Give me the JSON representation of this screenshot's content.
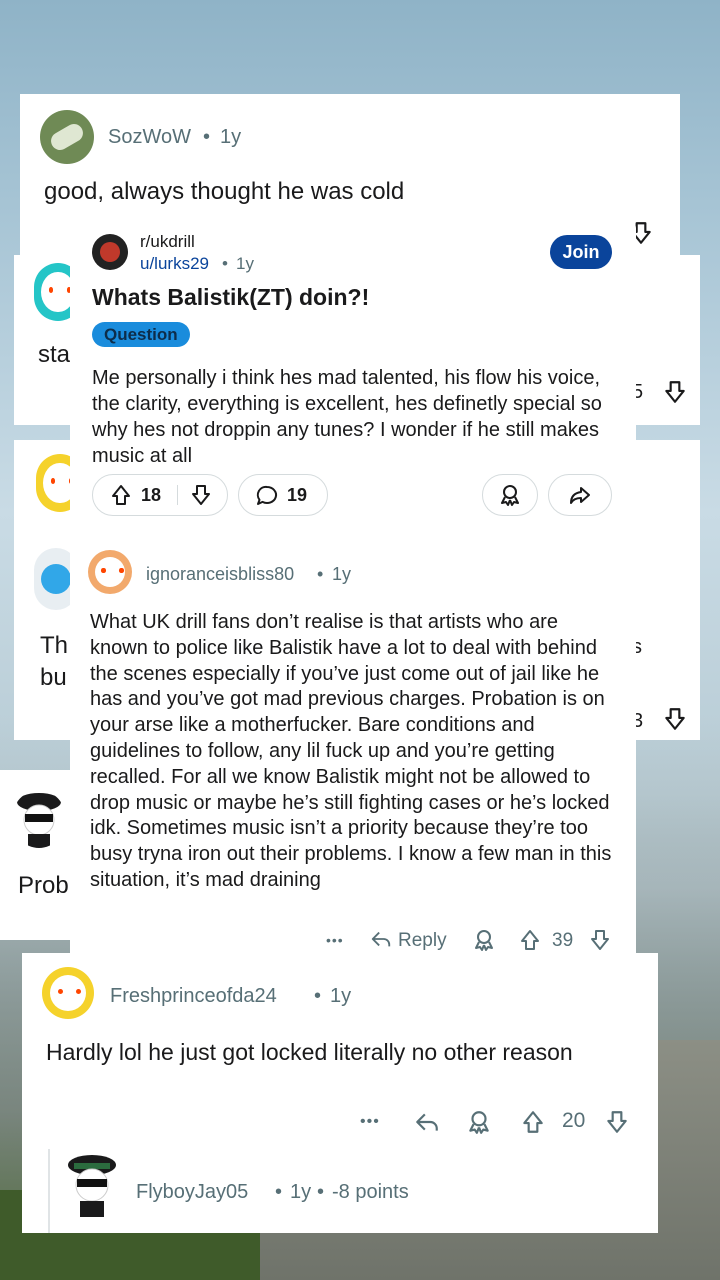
{
  "comment1": {
    "username": "SozWoW",
    "age": "1y",
    "body": "good, always thought he was cold"
  },
  "bg_partial": {
    "text_sta": "sta",
    "text_th": "Th",
    "text_bu": "bu",
    "text_prob": "Prob",
    "count_5": "5",
    "count_3": "3",
    "text_s": "s"
  },
  "post": {
    "subreddit": "r/ukdrill",
    "author": "u/lurks29",
    "age": "1y",
    "join_label": "Join",
    "title": "Whats Balistik(ZT) doin?!",
    "flair": "Question",
    "body": "Me personally i think hes mad talented, his flow his voice, the clarity, everything is excellent, hes definetly special so why hes not droppin any tunes? I wonder if he still makes music at all",
    "upvotes": "18",
    "comments": "19"
  },
  "comment2": {
    "username": "ignoranceisbliss80",
    "age": "1y",
    "body": "What UK drill fans don’t realise is that artists who are known to police like Balistik have a lot to deal with behind the scenes especially if you’ve just come out of jail like he has and you’ve got mad previous charges. Probation is on your arse like a motherfucker. Bare conditions and guidelines to follow, any lil fuck up and you’re getting recalled. For all we know Balistik might not be allowed to drop music or maybe he’s still fighting cases or he’s locked idk. Sometimes music isn’t a priority because they’re too busy tryna iron out their problems. I know a few man in this situation, it’s mad draining",
    "more": "•••",
    "reply_label": "Reply",
    "votes": "39"
  },
  "comment3": {
    "username": "Freshprinceofda24",
    "age": "1y",
    "body": "Hardly lol he just got locked literally no other reason",
    "more": "•••",
    "votes": "20"
  },
  "comment4": {
    "username": "FlyboyJay05",
    "age": "1y",
    "points": "-8 points"
  },
  "colors": {
    "join_bg": "#0a449b",
    "flair_bg": "#1a8cdc",
    "text": "#1a1a1b",
    "muted": "#576f76"
  },
  "icons": [
    "upvote-icon",
    "downvote-icon",
    "comment-icon",
    "award-icon",
    "share-icon",
    "reply-icon",
    "more-icon"
  ]
}
